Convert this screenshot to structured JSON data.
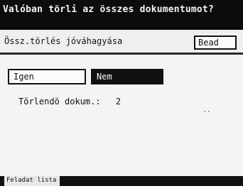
{
  "header": {
    "title": "Valóban törli az összes dokumentumot?"
  },
  "subbar": {
    "label": "Össz.törlés jóváhagyása",
    "bead_label": "Bead"
  },
  "buttons": {
    "igen": "Igen",
    "nem": "Nem"
  },
  "count": {
    "label": "Törlendö dokum.:",
    "value": "2"
  },
  "misc": {
    "dots": ".."
  },
  "footer": {
    "tab": "Feladat lista"
  }
}
